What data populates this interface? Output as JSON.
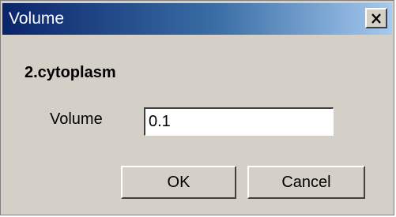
{
  "window": {
    "title": "Volume",
    "close_icon": "close-x-icon"
  },
  "section": {
    "title": "2.cytoplasm"
  },
  "field": {
    "label": "Volume",
    "value": "0.1"
  },
  "buttons": {
    "ok_label": "OK",
    "cancel_label": "Cancel"
  },
  "colors": {
    "titlebar_start": "#0a246a",
    "titlebar_end": "#a6caf0",
    "window_bg": "#d4d0c8"
  }
}
